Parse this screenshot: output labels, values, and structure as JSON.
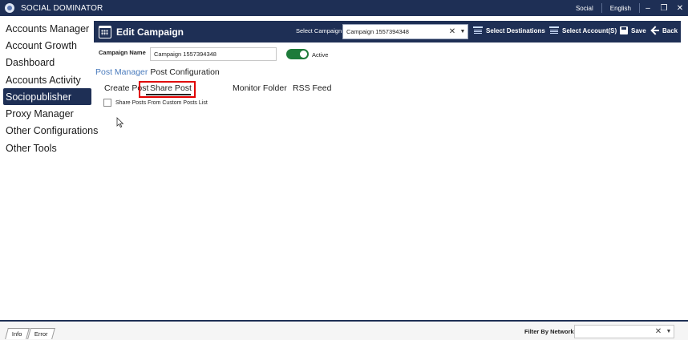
{
  "titlebar": {
    "app_title": "SOCIAL DOMINATOR",
    "network": "Social",
    "language": "English",
    "minimize": "–",
    "restore": "❐",
    "close": "✕"
  },
  "sidebar": {
    "items": [
      {
        "label": "Accounts Manager",
        "active": false
      },
      {
        "label": "Account Growth",
        "active": false
      },
      {
        "label": "Dashboard",
        "active": false
      },
      {
        "label": "Accounts Activity",
        "active": false
      },
      {
        "label": "Sociopublisher",
        "active": true
      },
      {
        "label": "Proxy Manager",
        "active": false
      },
      {
        "label": "Other Configurations",
        "active": false
      },
      {
        "label": "Other Tools",
        "active": false
      }
    ]
  },
  "header": {
    "title": "Edit Campaign",
    "select_campaign_label": "Select Campaign",
    "campaign_value": "Campaign 1557394348",
    "select_destinations": "Select Destinations",
    "select_accounts": "Select Account(S)",
    "save": "Save",
    "back": "Back"
  },
  "campaign": {
    "name_label": "Campaign Name",
    "name_value": "Campaign 1557394348",
    "active_label": "Active",
    "active": true
  },
  "breadcrumb": {
    "link": "Post Manager",
    "current": "Post Configuration"
  },
  "tabs": {
    "create_post": "Create Post",
    "share_post": "Share Post",
    "rss_feed": "RSS Feed",
    "monitor_folder": "Monitor Folder",
    "selected": "Share Post"
  },
  "share_options": {
    "custom_list_label": "Share Posts From Custom Posts List",
    "checked": false
  },
  "bottom": {
    "tab_info": "Info",
    "tab_error": "Error",
    "filter_label": "Filter By Network"
  },
  "colors": {
    "primary": "#1e2f55",
    "toggle_on": "#1e7b3a",
    "highlight": "#e00000",
    "link": "#4a7bbd"
  }
}
